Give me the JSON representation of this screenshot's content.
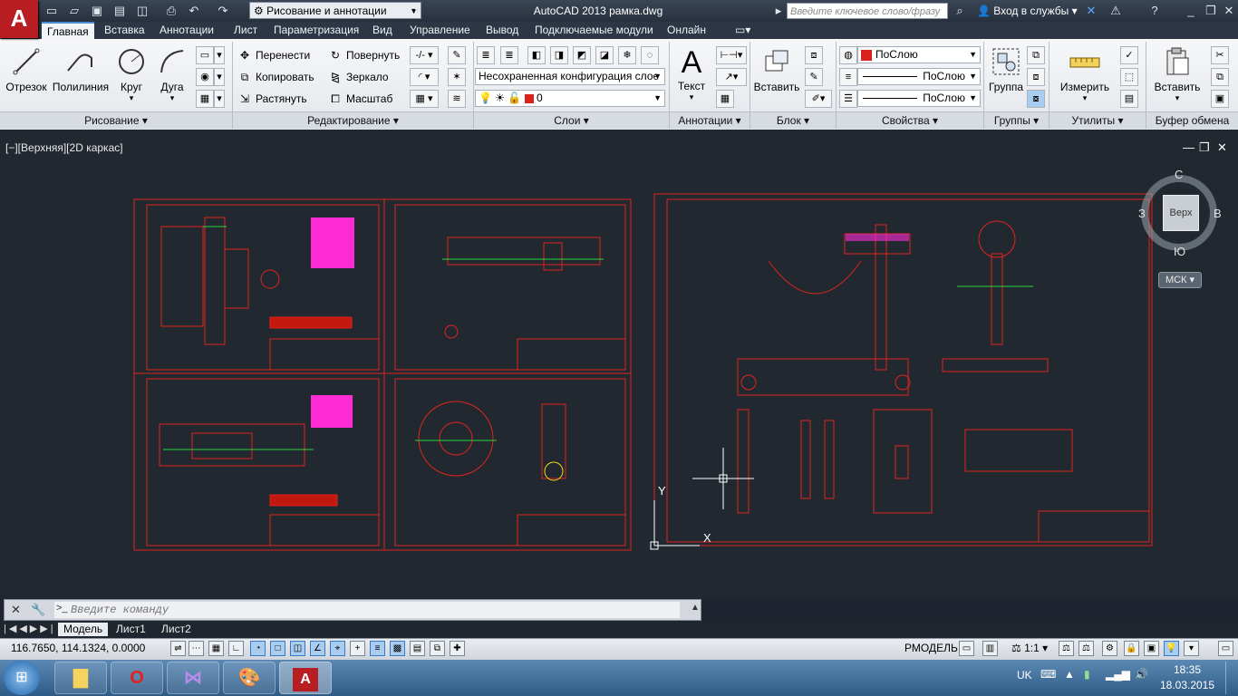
{
  "title_bar": {
    "app_logo": "A",
    "workspace": "Рисование и аннотации",
    "window_title": "AutoCAD 2013    рамка.dwg",
    "search_placeholder": "Введите ключевое слово/фразу",
    "sign_in": "Вход в службы",
    "help": "?"
  },
  "tabs": [
    "Главная",
    "Вставка",
    "Аннотации",
    "Лист",
    "Параметризация",
    "Вид",
    "Управление",
    "Вывод",
    "Подключаемые модули",
    "Онлайн"
  ],
  "ribbon": {
    "draw": {
      "title": "Рисование",
      "line": "Отрезок",
      "polyline": "Полилиния",
      "circle": "Круг",
      "arc": "Дуга"
    },
    "modify": {
      "title": "Редактирование",
      "move": "Перенести",
      "rotate": "Повернуть",
      "copy": "Копировать",
      "mirror": "Зеркало",
      "stretch": "Растянуть",
      "scale": "Масштаб"
    },
    "layers": {
      "title": "Слои",
      "layer_state": "Несохраненная конфигурация слое",
      "current_layer": "0"
    },
    "annotation": {
      "title": "Аннотации",
      "text": "Текст"
    },
    "block": {
      "title": "Блок",
      "insert": "Вставить"
    },
    "properties": {
      "title": "Свойства",
      "color": "ПоСлою",
      "linetype": "ПоСлою",
      "lineweight": "ПоСлою"
    },
    "groups": {
      "title": "Группы",
      "group": "Группа"
    },
    "utilities": {
      "title": "Утилиты",
      "measure": "Измерить"
    },
    "clipboard": {
      "title": "Буфер обмена",
      "paste": "Вставить"
    }
  },
  "viewport": {
    "label": "[−][Верхняя][2D каркас]",
    "viewcube": {
      "top": "Верх",
      "north": "С",
      "south": "Ю",
      "east": "В",
      "west": "З",
      "ucs": "МСК"
    }
  },
  "command_line": {
    "placeholder": "Введите команду"
  },
  "layout_tabs": [
    "Модель",
    "Лист1",
    "Лист2"
  ],
  "status_bar": {
    "coordinates": "116.7650, 114.1324, 0.0000",
    "space": "РМОДЕЛЬ",
    "scale": "1:1"
  },
  "taskbar": {
    "language": "UK",
    "time": "18:35",
    "date": "18.03.2015"
  },
  "colors": {
    "drawing_bg": "#212830",
    "frame_red": "#e0251b",
    "magenta": "#ff2cd6",
    "green": "#22d63a",
    "yellow": "#f2e218"
  }
}
